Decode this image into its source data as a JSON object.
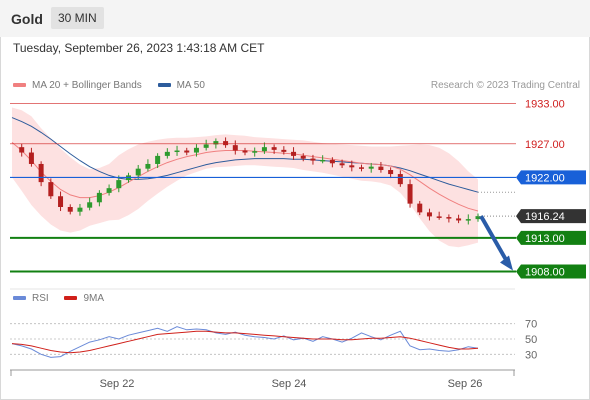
{
  "header": {
    "symbol": "Gold",
    "timeframe": "30 MIN"
  },
  "datetime": "Tuesday, September 26, 2023 1:43:18 AM CET",
  "legend": {
    "ma20": {
      "label": "MA 20 + Bollinger Bands",
      "color": "#f08080"
    },
    "ma50": {
      "label": "MA 50",
      "color": "#2d5c9c"
    }
  },
  "copyright": "Research © 2023 Trading Central",
  "rsi_legend": {
    "rsi": {
      "label": "RSI",
      "color": "#6a8ad8"
    },
    "ma9": {
      "label": "9MA",
      "color": "#d0201a"
    }
  },
  "chart_data": [
    {
      "type": "candlestick",
      "title": "Gold",
      "x_tick_labels": [
        "Sep 22",
        "Sep 24",
        "Sep 26"
      ],
      "ylim": [
        1906,
        1935
      ],
      "levels": [
        {
          "label": "1933.00",
          "value": 1933.0,
          "style": "thin-red"
        },
        {
          "label": "1927.00",
          "value": 1927.0,
          "style": "thin-red"
        },
        {
          "label": "1922.00",
          "value": 1922.0,
          "style": "pivot-blue"
        },
        {
          "label": "1916.24",
          "value": 1916.24,
          "style": "last-price"
        },
        {
          "label": "1913.00",
          "value": 1913.0,
          "style": "support-green"
        },
        {
          "label": "1908.00",
          "value": 1908.0,
          "style": "support-green"
        }
      ],
      "colors": {
        "up": "#2e9a2e",
        "down": "#b42020",
        "resistance": "#d02020",
        "pivot": "#1860d8",
        "support": "#128012",
        "band_fill": "#fde1e1",
        "ma20": "#f08080",
        "ma50": "#2d5c9c",
        "arrow": "#2a5ca8"
      },
      "projection": {
        "from": 1916.24,
        "to": 1908.0,
        "direction": "down"
      },
      "series": [
        {
          "name": "Price",
          "values": [
            1926.5,
            1925.7,
            1924.0,
            1921.3,
            1919.2,
            1917.6,
            1916.9,
            1917.5,
            1918.3,
            1919.7,
            1920.4,
            1921.6,
            1922.3,
            1923.3,
            1924.0,
            1925.2,
            1925.8,
            1926.0,
            1925.7,
            1926.4,
            1926.9,
            1927.4,
            1926.8,
            1926.0,
            1925.7,
            1925.9,
            1926.5,
            1926.1,
            1925.8,
            1925.2,
            1924.8,
            1924.5,
            1924.6,
            1924.1,
            1923.8,
            1923.5,
            1923.3,
            1923.6,
            1923.1,
            1922.5,
            1921.0,
            1918.1,
            1916.8,
            1916.2,
            1916.1,
            1915.9,
            1915.6,
            1915.8,
            1916.24
          ]
        },
        {
          "name": "MA 20",
          "values": [
            1927.2,
            1926.0,
            1924.5,
            1922.8,
            1921.4,
            1920.2,
            1919.4,
            1919.0,
            1919.0,
            1919.3,
            1919.8,
            1920.5,
            1921.3,
            1922.1,
            1922.9,
            1923.6,
            1924.2,
            1924.7,
            1925.1,
            1925.4,
            1925.7,
            1925.9,
            1926.0,
            1926.0,
            1926.0,
            1925.9,
            1925.8,
            1925.7,
            1925.6,
            1925.5,
            1925.3,
            1925.1,
            1924.9,
            1924.7,
            1924.5,
            1924.3,
            1924.1,
            1924.0,
            1923.9,
            1923.7,
            1923.2,
            1922.4,
            1921.4,
            1920.4,
            1919.5,
            1918.7,
            1918.0,
            1917.4,
            1917.0
          ]
        },
        {
          "name": "MA 50",
          "values": [
            1930.9,
            1930.3,
            1929.6,
            1928.7,
            1927.7,
            1926.6,
            1925.5,
            1924.5,
            1923.6,
            1922.9,
            1922.3,
            1921.9,
            1921.7,
            1921.7,
            1921.8,
            1922.0,
            1922.3,
            1922.7,
            1923.1,
            1923.5,
            1923.9,
            1924.2,
            1924.4,
            1924.6,
            1924.7,
            1924.8,
            1924.8,
            1924.8,
            1924.8,
            1924.7,
            1924.7,
            1924.6,
            1924.5,
            1924.4,
            1924.3,
            1924.2,
            1924.1,
            1924.0,
            1923.9,
            1923.7,
            1923.4,
            1923.0,
            1922.5,
            1922.0,
            1921.5,
            1921.0,
            1920.6,
            1920.2,
            1919.8
          ]
        },
        {
          "name": "Bollinger Upper",
          "values": [
            1932.4,
            1932.0,
            1931.1,
            1929.3,
            1927.8,
            1926.3,
            1925.0,
            1923.9,
            1923.2,
            1923.4,
            1924.0,
            1925.3,
            1926.2,
            1926.9,
            1927.3,
            1927.6,
            1927.8,
            1927.9,
            1927.9,
            1928.0,
            1928.1,
            1928.3,
            1928.4,
            1928.3,
            1928.2,
            1928.0,
            1927.9,
            1927.8,
            1927.7,
            1927.6,
            1927.5,
            1927.3,
            1927.1,
            1927.0,
            1926.9,
            1926.8,
            1926.7,
            1926.6,
            1926.6,
            1926.6,
            1926.7,
            1926.8,
            1926.9,
            1926.8,
            1926.4,
            1925.6,
            1924.4,
            1922.9,
            1921.7
          ]
        },
        {
          "name": "Bollinger Lower",
          "values": [
            1922.0,
            1920.0,
            1917.9,
            1916.3,
            1915.0,
            1914.1,
            1913.8,
            1914.1,
            1914.8,
            1915.2,
            1915.6,
            1915.7,
            1916.4,
            1917.3,
            1918.5,
            1919.6,
            1920.6,
            1921.5,
            1922.3,
            1922.8,
            1923.3,
            1923.5,
            1923.6,
            1923.7,
            1923.8,
            1923.8,
            1923.7,
            1923.6,
            1923.5,
            1923.4,
            1923.1,
            1922.9,
            1922.7,
            1922.4,
            1922.1,
            1921.8,
            1921.5,
            1921.4,
            1921.2,
            1920.8,
            1919.7,
            1918.0,
            1915.9,
            1914.0,
            1912.6,
            1911.8,
            1911.6,
            1911.9,
            1912.3
          ]
        }
      ]
    },
    {
      "type": "line",
      "title": "RSI",
      "y_tick_labels": [
        "70",
        "50",
        "30"
      ],
      "ylim": [
        20,
        80
      ],
      "series": [
        {
          "name": "RSI",
          "values": [
            44,
            41,
            37,
            30,
            26,
            27,
            34,
            40,
            46,
            49,
            53,
            50,
            55,
            58,
            61,
            64,
            60,
            66,
            62,
            63,
            62,
            58,
            56,
            59,
            55,
            53,
            52,
            50,
            54,
            49,
            51,
            47,
            53,
            50,
            46,
            51,
            58,
            53,
            49,
            55,
            60,
            41,
            36,
            37,
            35,
            34,
            36,
            40,
            38
          ]
        },
        {
          "name": "9MA",
          "values": [
            44,
            43,
            41,
            38,
            35,
            33,
            32,
            33,
            35,
            38,
            41,
            44,
            47,
            50,
            53,
            56,
            57,
            58,
            59,
            60,
            60,
            59,
            58,
            58,
            57,
            56,
            55,
            54,
            53,
            52,
            51,
            50,
            50,
            50,
            49,
            49,
            50,
            51,
            51,
            52,
            53,
            51,
            48,
            45,
            42,
            39,
            37,
            37,
            38
          ]
        }
      ]
    }
  ]
}
